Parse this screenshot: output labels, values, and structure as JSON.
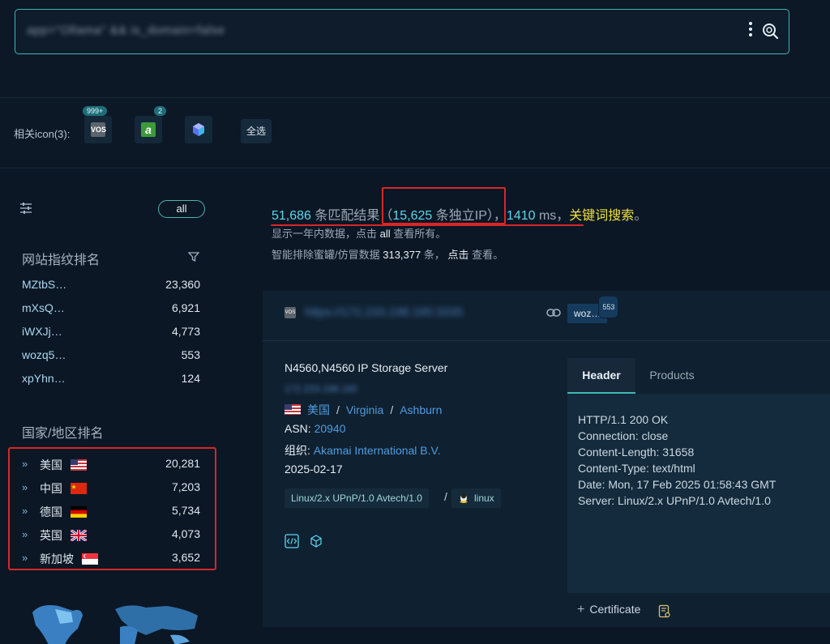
{
  "search": {
    "query": "app=\"Ollama\" && is_domain=false"
  },
  "icons_row": {
    "label": "相关icon(3):",
    "icons": [
      {
        "name": "vos",
        "badge": "999+",
        "text": "VOS"
      },
      {
        "name": "a-green",
        "badge": "2",
        "text": "a"
      },
      {
        "name": "cube-blue",
        "badge": "",
        "text": ""
      }
    ],
    "select_all": "全选"
  },
  "sidebar": {
    "all_pill": "all",
    "fingerprint_title": "网站指纹排名",
    "fingerprints": [
      {
        "name": "MZtbS…",
        "count": "23,360"
      },
      {
        "name": "mXsQ…",
        "count": "6,921"
      },
      {
        "name": "iWXJj…",
        "count": "4,773"
      },
      {
        "name": "wozq5…",
        "count": "553"
      },
      {
        "name": "xpYhn…",
        "count": "124"
      }
    ],
    "country_title": "国家/地区排名",
    "countries": [
      {
        "name": "美国",
        "flag": "us",
        "count": "20,281"
      },
      {
        "name": "中国",
        "flag": "cn",
        "count": "7,203"
      },
      {
        "name": "德国",
        "flag": "de",
        "count": "5,734"
      },
      {
        "name": "英国",
        "flag": "gb",
        "count": "4,073"
      },
      {
        "name": "新加坡",
        "flag": "sg",
        "count": "3,652"
      }
    ]
  },
  "stats": {
    "total": "51,686",
    "total_label": " 条匹配结果（",
    "unique_ip": "15,625",
    "unique_label": " 条独立IP",
    "close": "），",
    "ms": "1410",
    "ms_label": " ms，",
    "keyword": "关键词搜索",
    "period": "。",
    "sub1_a": "显示一年内数据，点击 ",
    "sub1_all": "all",
    "sub1_b": " 查看所有。",
    "sub2_a": "智能排除蜜罐/仿冒数据 ",
    "sub2_num": "313,377",
    "sub2_b": " 条， ",
    "sub2_click": "点击",
    "sub2_c": " 查看。"
  },
  "result": {
    "url": "https://172.233.198.165:3335",
    "tag": "woz…",
    "tag_badge": "553",
    "title": "N4560,N4560 IP Storage Server",
    "ip": "172.233.198.165",
    "country": "美国",
    "region": "Virginia",
    "city": "Ashburn",
    "asn_label": "ASN: ",
    "asn": "20940",
    "org_label": "组织: ",
    "org": "Akamai International B.V.",
    "date": "2025-02-17",
    "server_pill": "Linux/2.x UPnP/1.0 Avtech/1.0",
    "os_pill": "linux",
    "tabs": [
      "Header",
      "Products"
    ],
    "header_lines": [
      "HTTP/1.1 200 OK",
      "Connection: close",
      "Content-Length: 31658",
      "Content-Type: text/html",
      "Date: Mon, 17 Feb 2025 01:58:43 GMT",
      "Server: Linux/2.x UPnP/1.0 Avtech/1.0"
    ],
    "certificate": "Certificate"
  }
}
